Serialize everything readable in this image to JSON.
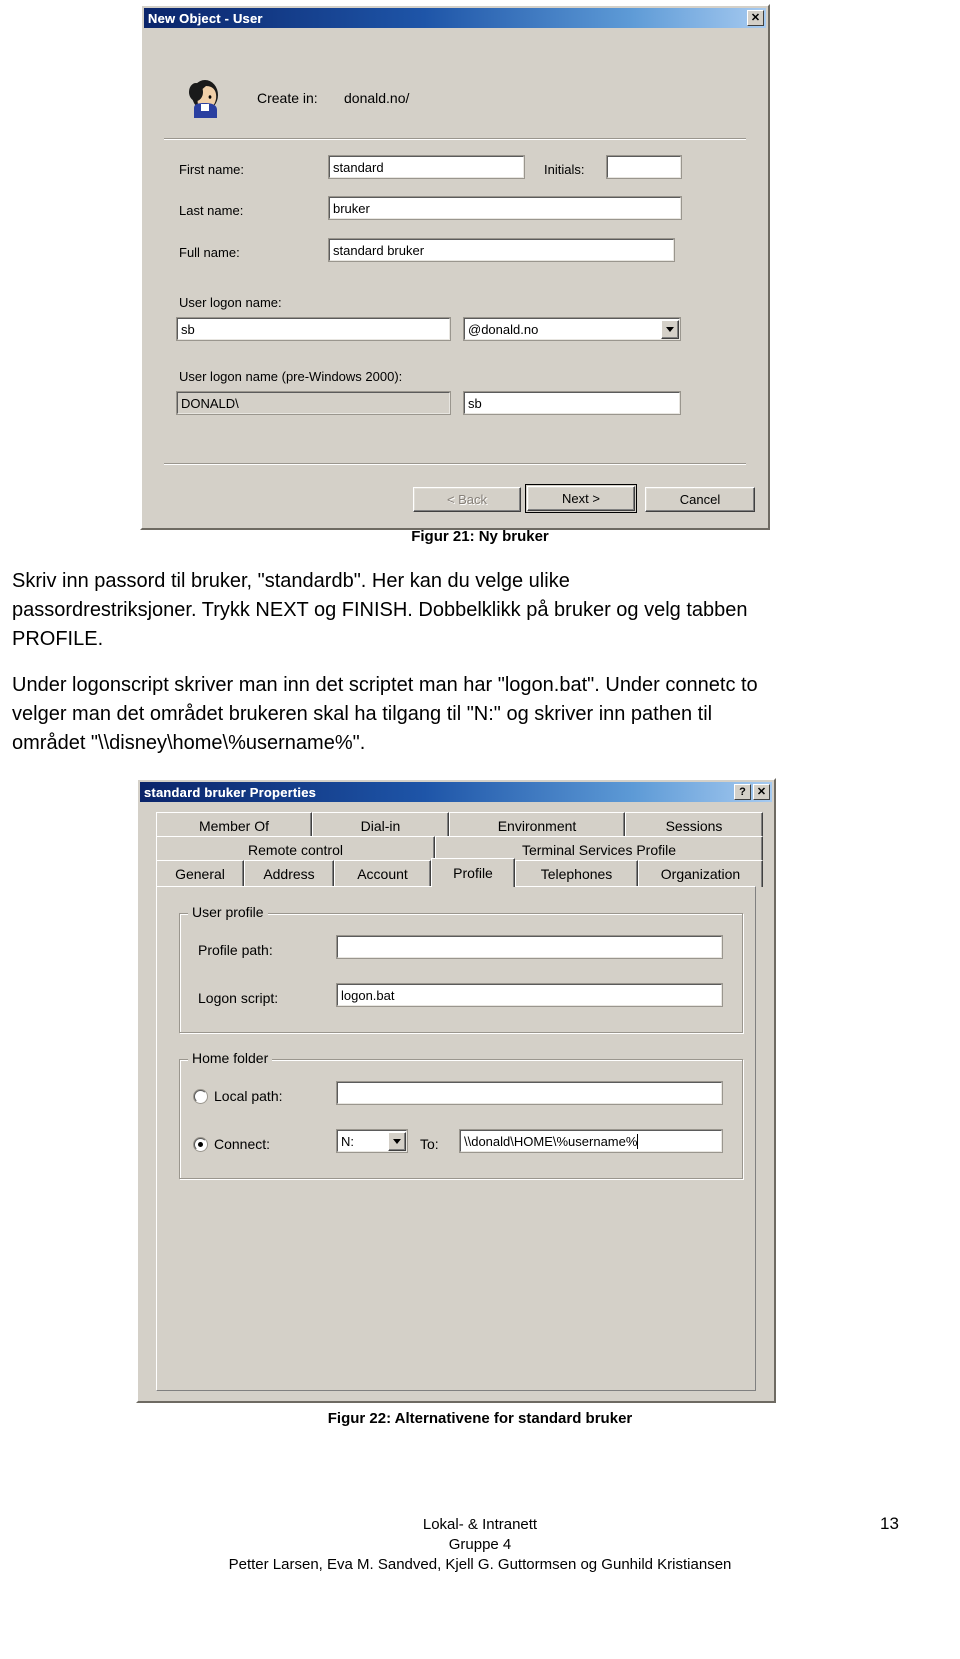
{
  "document": {
    "page_number": "13",
    "footer": {
      "line1": "Lokal- & Intranett",
      "line2": "Gruppe 4",
      "line3": "Petter Larsen, Eva M. Sandved, Kjell G. Guttormsen og Gunhild Kristiansen"
    }
  },
  "figure1": {
    "caption": "Figur 21: Ny bruker",
    "window": {
      "title": "New Object - User",
      "close_label": "✕",
      "create_in_label": "Create in:",
      "create_in_value": "donald.no/",
      "fields": {
        "first_name_label": "First name:",
        "first_name_value": "standard",
        "initials_label": "Initials:",
        "initials_value": "",
        "last_name_label": "Last name:",
        "last_name_value": "bruker",
        "full_name_label": "Full name:",
        "full_name_value": "standard bruker",
        "user_logon_name_label": "User logon name:",
        "user_logon_name_value": "sb",
        "domain_suffix_value": "@donald.no",
        "pre2000_label": "User logon name (pre-Windows 2000):",
        "pre2000_domain_value": "DONALD\\",
        "pre2000_value": "sb"
      },
      "buttons": {
        "back": "< Back",
        "next": "Next >",
        "cancel": "Cancel"
      }
    }
  },
  "body_text": {
    "paragraph1_line1": "Skriv inn passord til bruker, \"standardb\". Her kan du velge ulike",
    "paragraph1_line2": "passordrestriksjoner. Trykk NEXT og FINISH. Dobbelklikk på bruker og velg tabben",
    "paragraph1_line3": "PROFILE.",
    "paragraph2_line1": "Under logonscript skriver man inn det scriptet man har \"logon.bat\". Under connetc to",
    "paragraph2_line2": "velger man det området brukeren skal ha tilgang til \"N:\" og skriver inn pathen til",
    "paragraph2_line3": "området \"\\\\disney\\home\\%username%\"."
  },
  "figure2": {
    "caption": "Figur 22: Alternativene for standard bruker",
    "window": {
      "title": "standard bruker Properties",
      "help_label": "?",
      "close_label": "✕",
      "tabs_row1": [
        "Member Of",
        "Dial-in",
        "Environment",
        "Sessions"
      ],
      "tabs_row2": [
        "Remote control",
        "Terminal Services Profile"
      ],
      "tabs_row3": [
        "General",
        "Address",
        "Account",
        "Profile",
        "Telephones",
        "Organization"
      ],
      "active_tab": "Profile",
      "user_profile": {
        "group_label": "User profile",
        "profile_path_label": "Profile path:",
        "profile_path_value": "",
        "logon_script_label": "Logon script:",
        "logon_script_value": "logon.bat"
      },
      "home_folder": {
        "group_label": "Home folder",
        "local_path_label": "Local path:",
        "local_path_value": "",
        "connect_label": "Connect:",
        "connect_drive_value": "N:",
        "to_label": "To:",
        "to_value": "\\\\donald\\HOME\\%username%",
        "selected_option": "Connect:"
      }
    }
  }
}
